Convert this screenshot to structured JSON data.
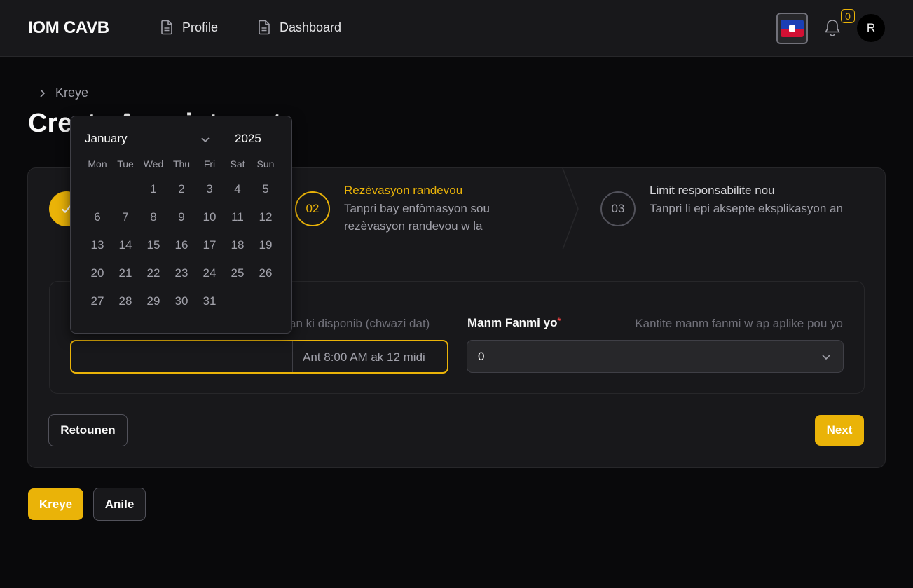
{
  "header": {
    "brand": "IOM CAVB",
    "nav": [
      {
        "label": "Profile",
        "icon": "document-icon"
      },
      {
        "label": "Dashboard",
        "icon": "document-icon"
      }
    ],
    "notification_count": "0",
    "avatar_initial": "R",
    "flag": "haiti-flag"
  },
  "breadcrumb": {
    "current": "Kreye"
  },
  "page_title": "Create Appointment",
  "stepper": {
    "steps": [
      {
        "number": "01",
        "title": "",
        "description": "",
        "state": "complete"
      },
      {
        "number": "02",
        "title": "Rezèvasyon randevou",
        "description": "Tanpri bay enfòmasyon sou rezèvasyon randevou w la",
        "state": "active"
      },
      {
        "number": "03",
        "title": "Limit responsabilite nou",
        "description": "Tanpri li epi aksepte eksplikasyon an",
        "state": "upcoming"
      }
    ]
  },
  "form": {
    "date_hint": "an ki disponib (chwazi dat)",
    "date_value": "",
    "date_addon": "Ant 8:00 AM ak 12 midi",
    "family_label": "Manm Fanmi yo",
    "family_required": "*",
    "family_hint": "Kantite manm fanmi w ap aplike pou yo",
    "family_value": "0"
  },
  "buttons": {
    "back": "Retounen",
    "next": "Next",
    "create": "Kreye",
    "cancel": "Anile"
  },
  "calendar": {
    "month": "January",
    "year": "2025",
    "weekdays": [
      "Mon",
      "Tue",
      "Wed",
      "Thu",
      "Fri",
      "Sat",
      "Sun"
    ],
    "leading_blanks": 2,
    "days": [
      "1",
      "2",
      "3",
      "4",
      "5",
      "6",
      "7",
      "8",
      "9",
      "10",
      "11",
      "12",
      "13",
      "14",
      "15",
      "16",
      "17",
      "18",
      "19",
      "20",
      "21",
      "22",
      "23",
      "24",
      "25",
      "26",
      "27",
      "28",
      "29",
      "30",
      "31"
    ]
  },
  "colors": {
    "accent": "#eab308",
    "background": "#09090b",
    "surface": "#18181b",
    "required": "#ef4444"
  }
}
